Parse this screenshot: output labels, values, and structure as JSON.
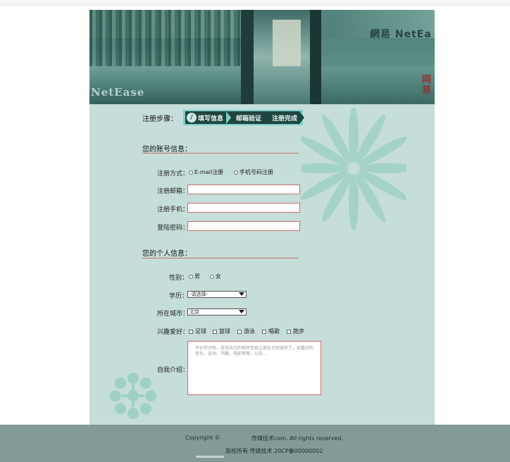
{
  "banner": {
    "logo_left": "NetEase",
    "logo_right": "網易 NetEa",
    "logo_right_mark": "网易"
  },
  "steps": {
    "label": "注册步骤：",
    "items": [
      "填写信息",
      "邮箱验证",
      "注册完成"
    ],
    "icon": "pen-icon"
  },
  "account": {
    "title": "您的账号信息：",
    "method_label": "注册方式：",
    "method_options": [
      "E-mail注册",
      "手机号码注册"
    ],
    "email_label": "注册邮箱：",
    "email_value": "",
    "phone_label": "注册手机：",
    "phone_value": "",
    "password_label": "登陆密码：",
    "password_value": ""
  },
  "personal": {
    "title": "您的个人信息：",
    "gender_label": "性别：",
    "gender_options": [
      "男",
      "女"
    ],
    "education_label": "学历：",
    "education_value": "-请选择-",
    "city_label": "所在城市：",
    "city_value": "北京",
    "hobby_label": "兴趣爱好：",
    "hobbies": [
      "足球",
      "篮球",
      "游泳",
      "唱歌",
      "跑步"
    ],
    "intro_label": "自我介绍：",
    "intro_placeholder": "评价你对啥，说说自己的相关信息让朋友也知道你了，如喜好的音乐、运动、书籍、电影等等，以及..."
  },
  "footer": {
    "copyright_prefix": "Copyright ©",
    "copyright_suffix": "传媒技术com. All rights reserved.",
    "icp": "版权所有 传媒技术 20CP备00000002"
  },
  "colors": {
    "background": "#c5ded9",
    "accent_line": "#c96e6e",
    "step_dark": "#1f4541",
    "step_light": "#7ccfca",
    "footer": "#839b98"
  }
}
